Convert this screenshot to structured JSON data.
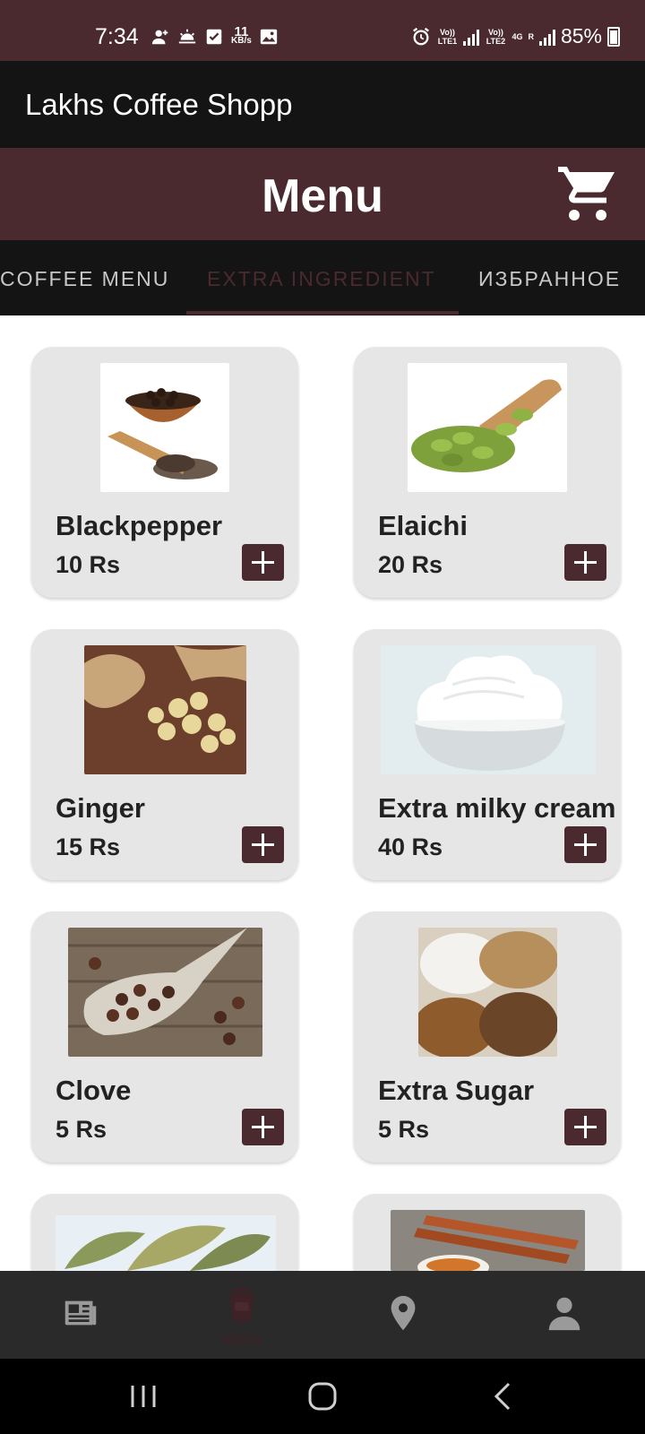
{
  "status_bar": {
    "time": "7:34",
    "net_speed_value": "11",
    "net_speed_unit": "KB/s",
    "sim1_label": "Vo)) LTE1",
    "sim2_label": "Vo)) LTE2",
    "network_type": "4G",
    "roaming": "R",
    "battery": "85%"
  },
  "app_bar": {
    "title": "Lakhs Coffee Shopp"
  },
  "header": {
    "title": "Menu",
    "cart_icon": "shopping-cart-icon"
  },
  "tabs": [
    {
      "label": "COFFEE MENU",
      "active": false
    },
    {
      "label": "EXTRA INGREDIENT",
      "active": true
    },
    {
      "label": "ИЗБРАННОЕ",
      "active": false
    }
  ],
  "items": [
    {
      "name": "Blackpepper",
      "price": "10 Rs",
      "image": "blackpepper-image"
    },
    {
      "name": "Elaichi",
      "price": "20 Rs",
      "image": "elaichi-image"
    },
    {
      "name": "Ginger",
      "price": "15 Rs",
      "image": "ginger-image"
    },
    {
      "name": "Extra milky cream",
      "price": "40 Rs",
      "image": "cream-image"
    },
    {
      "name": "Clove",
      "price": "5 Rs",
      "image": "clove-image"
    },
    {
      "name": "Extra Sugar",
      "price": "5 Rs",
      "image": "sugar-image"
    },
    {
      "name": "",
      "price": "",
      "image": "bay-leaf-image"
    },
    {
      "name": "",
      "price": "",
      "image": "cinnamon-image"
    }
  ],
  "bottom_nav": [
    {
      "icon": "newspaper-icon",
      "label": ""
    },
    {
      "icon": "coffee-cup-icon",
      "label": "Menu",
      "active": true
    },
    {
      "icon": "location-pin-icon",
      "label": ""
    },
    {
      "icon": "person-icon",
      "label": ""
    }
  ],
  "system_nav": [
    "recents-icon",
    "home-icon",
    "back-icon"
  ],
  "colors": {
    "primary": "#4a2a2e",
    "bar": "#141414",
    "card": "#e6e6e6",
    "nav": "#2a2a2a"
  }
}
